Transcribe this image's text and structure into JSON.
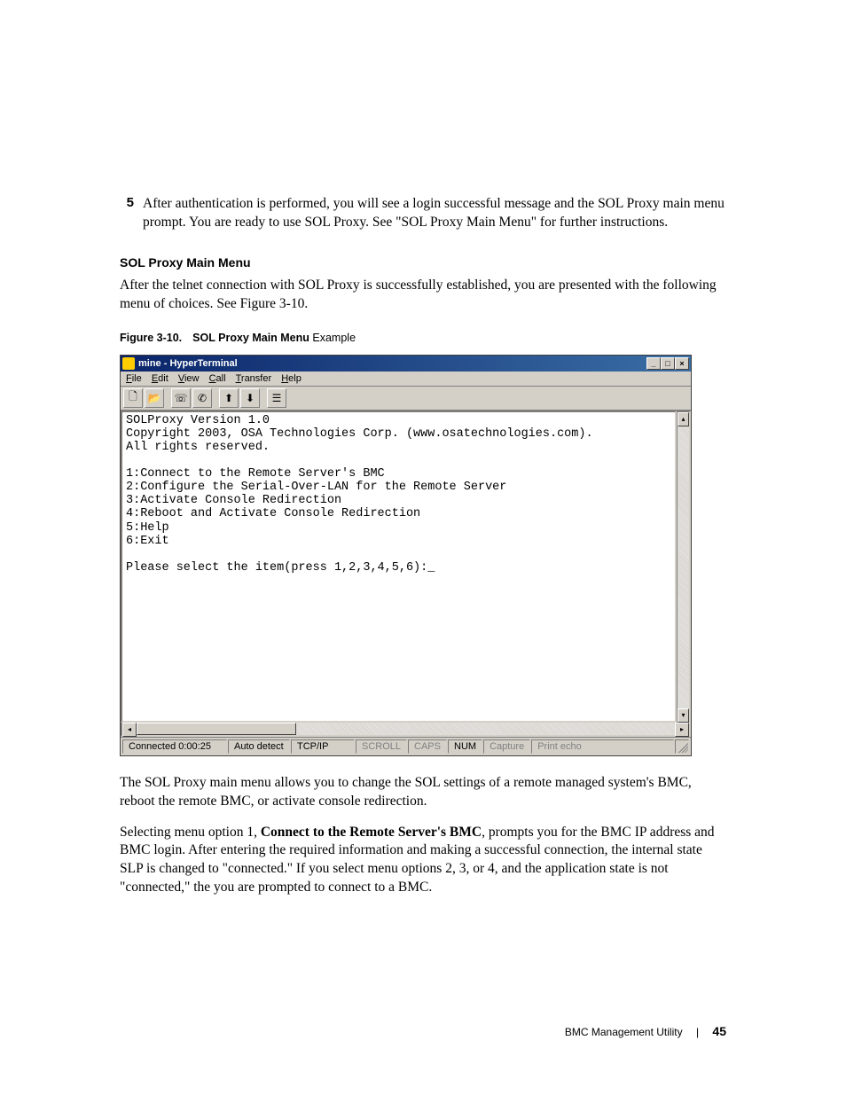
{
  "step": {
    "number": "5",
    "text": "After authentication is performed, you will see a login successful message and the SOL Proxy main menu prompt. You are ready to use SOL Proxy. See \"SOL Proxy Main Menu\" for further instructions."
  },
  "section_heading": "SOL Proxy Main Menu",
  "intro_para": "After the telnet connection with SOL Proxy is successfully established, you are presented with the following menu of choices. See Figure 3-10.",
  "figure": {
    "number": "Figure 3-10.",
    "title_bold": "SOL Proxy Main Menu",
    "title_rest": " Example"
  },
  "hyperterminal": {
    "title": "mine - HyperTerminal",
    "menu": {
      "file": "File",
      "edit": "Edit",
      "view": "View",
      "call": "Call",
      "transfer": "Transfer",
      "help": "Help"
    },
    "toolbar_icons": [
      "new-file-icon",
      "open-folder-icon",
      "phone-dial-icon",
      "phone-hangup-icon",
      "send-icon",
      "receive-icon",
      "properties-icon"
    ],
    "terminal_lines": [
      "SOLProxy Version 1.0",
      "Copyright 2003, OSA Technologies Corp. (www.osatechnologies.com).",
      "All rights reserved.",
      "",
      "1:Connect to the Remote Server's BMC",
      "2:Configure the Serial-Over-LAN for the Remote Server",
      "3:Activate Console Redirection",
      "4:Reboot and Activate Console Redirection",
      "5:Help",
      "6:Exit",
      "",
      "Please select the item(press 1,2,3,4,5,6):_"
    ],
    "status": {
      "connected": "Connected 0:00:25",
      "detect": "Auto detect",
      "protocol": "TCP/IP",
      "scroll": "SCROLL",
      "caps": "CAPS",
      "num": "NUM",
      "capture": "Capture",
      "printecho": "Print echo"
    }
  },
  "after_figure_para": "The SOL Proxy main menu allows you to change the SOL settings of a remote managed system's BMC, reboot the remote BMC, or activate console redirection.",
  "final_para_before_bold": "Selecting menu option 1, ",
  "final_para_bold": "Connect to the Remote Server's BMC",
  "final_para_after_bold": ", prompts you for the BMC IP address and BMC login. After entering the required information and making a successful connection, the internal state SLP is changed to \"connected.\" If you select menu options 2, 3, or 4, and the application state is not \"connected,\" the you are prompted to connect to a BMC.",
  "footer": {
    "section": "BMC Management Utility",
    "page": "45"
  }
}
